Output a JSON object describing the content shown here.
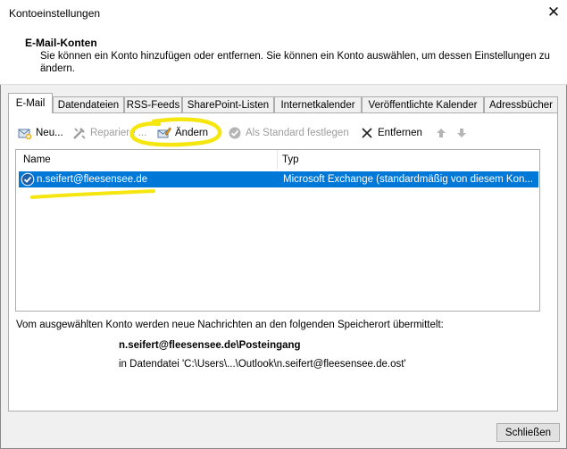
{
  "window": {
    "title": "Kontoeinstellungen",
    "close_glyph": "✕"
  },
  "header": {
    "title": "E-Mail-Konten",
    "description": "Sie können ein Konto hinzufügen oder entfernen. Sie können ein Konto auswählen, um dessen Einstellungen zu ändern."
  },
  "tabs": [
    {
      "label": "E-Mail",
      "active": true
    },
    {
      "label": "Datendateien"
    },
    {
      "label": "RSS-Feeds"
    },
    {
      "label": "SharePoint-Listen"
    },
    {
      "label": "Internetkalender"
    },
    {
      "label": "Veröffentlichte Kalender"
    },
    {
      "label": "Adressbücher"
    }
  ],
  "toolbar": {
    "new_label": "Neu...",
    "repair_label": "Repariere ...",
    "change_label": "Ändern",
    "set_default_label": "Als Standard festlegen",
    "remove_label": "Entfernen"
  },
  "list": {
    "headers": {
      "name": "Name",
      "type": "Typ"
    },
    "rows": [
      {
        "name": "n.seifert@fleesensee.de",
        "type": "Microsoft Exchange (standardmäßig von diesem Kon..."
      }
    ]
  },
  "info": {
    "text": "Vom ausgewählten Konto werden neue Nachrichten an den folgenden Speicherort übermittelt:",
    "path": "n.seifert@fleesensee.de\\Posteingang",
    "file": "in Datendatei 'C:\\Users\\...\\Outlook\\n.seifert@fleesensee.de.ost'"
  },
  "footer": {
    "close_label": "Schließen"
  },
  "colors": {
    "selection": "#0078d7",
    "annotation": "#f5e60f",
    "disabled_text": "#9d9d9d"
  }
}
